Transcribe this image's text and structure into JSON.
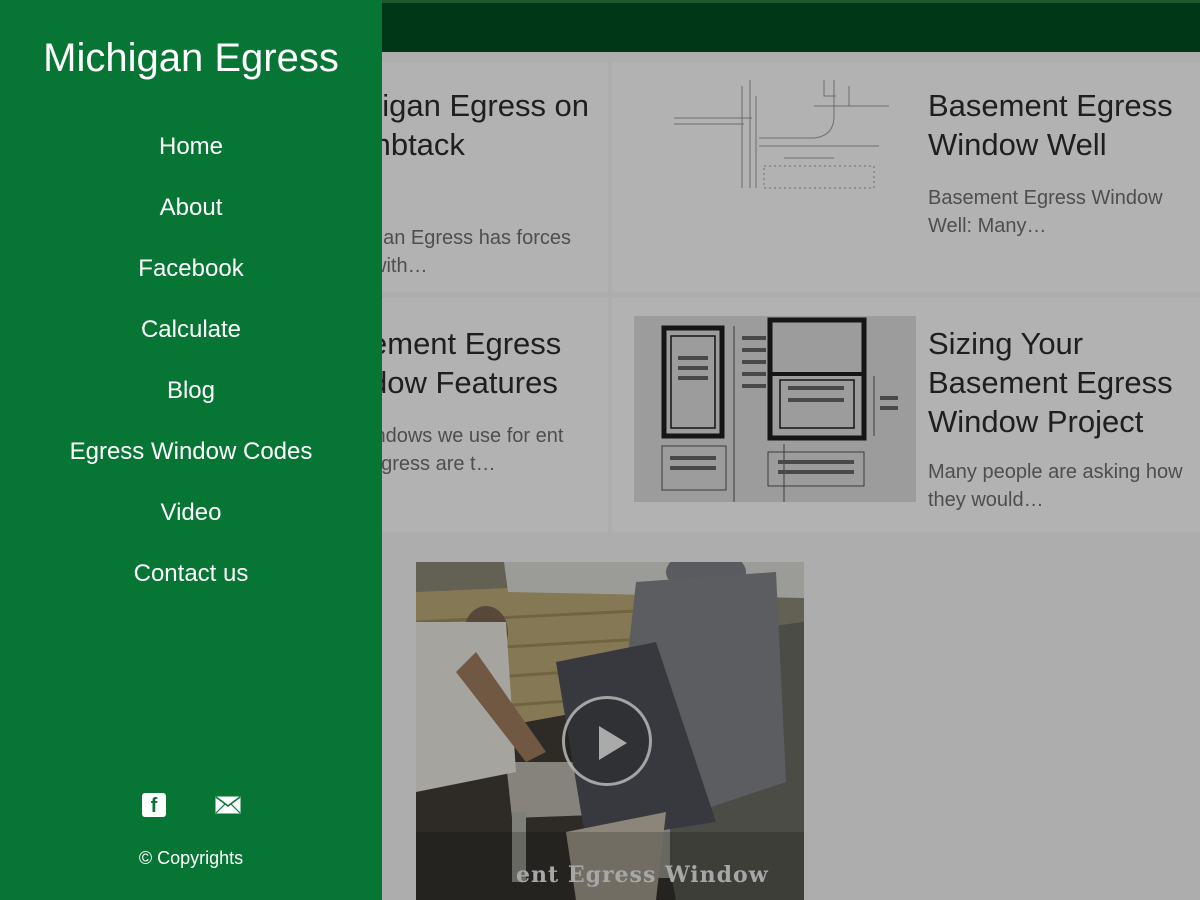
{
  "sidebar": {
    "brand": "Michigan Egress",
    "nav": [
      {
        "label": "Home"
      },
      {
        "label": "About"
      },
      {
        "label": "Facebook"
      },
      {
        "label": "Calculate"
      },
      {
        "label": "Blog"
      },
      {
        "label": "Egress Window Codes"
      },
      {
        "label": "Video"
      },
      {
        "label": "Contact us"
      }
    ],
    "social": {
      "facebook_icon": "facebook-icon",
      "email_icon": "mail-icon"
    },
    "copyright": "© Copyrights"
  },
  "posts": [
    {
      "title": "higan Egress on mbtack",
      "excerpt": "gan Egress has forces with…"
    },
    {
      "title": "Basement Egress Window Well",
      "excerpt": "Basement Egress Window Well: Many…"
    },
    {
      "title": "ement Egress dow Features",
      "excerpt": "indows we use for ent egress are t…"
    },
    {
      "title": "Sizing Your Basement Egress Window Project",
      "excerpt": "Many people are asking how they would…"
    }
  ],
  "video": {
    "caption": "ent Egress Window"
  },
  "colors": {
    "drawer": "#077635",
    "topbar": "#004d1f"
  }
}
